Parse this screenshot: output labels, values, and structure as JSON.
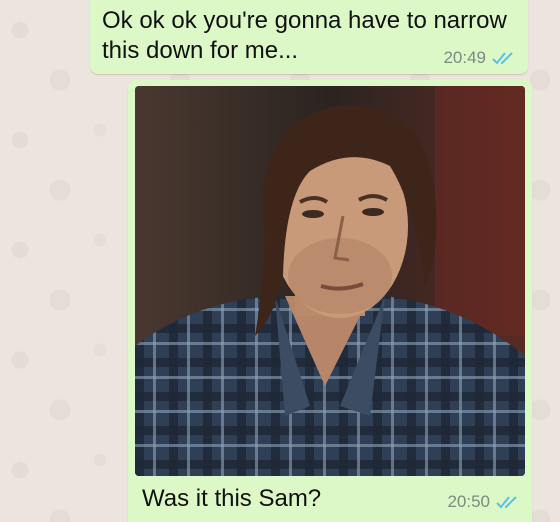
{
  "messages": [
    {
      "text": "Ok ok ok you're gonna have to narrow this down for me...",
      "time": "20:49",
      "status": "read"
    },
    {
      "image_alt": "photo of a man with shoulder-length brown hair wearing a plaid shirt",
      "text": "Was it this Sam?",
      "time": "20:50",
      "status": "read"
    }
  ],
  "colors": {
    "chat_background": "#ece5dd",
    "outgoing_bubble": "#dcf8c6",
    "read_ticks": "#4fc3f7",
    "timestamp": "#7c8a80"
  },
  "icons": {
    "read_receipt": "double-check-icon"
  }
}
